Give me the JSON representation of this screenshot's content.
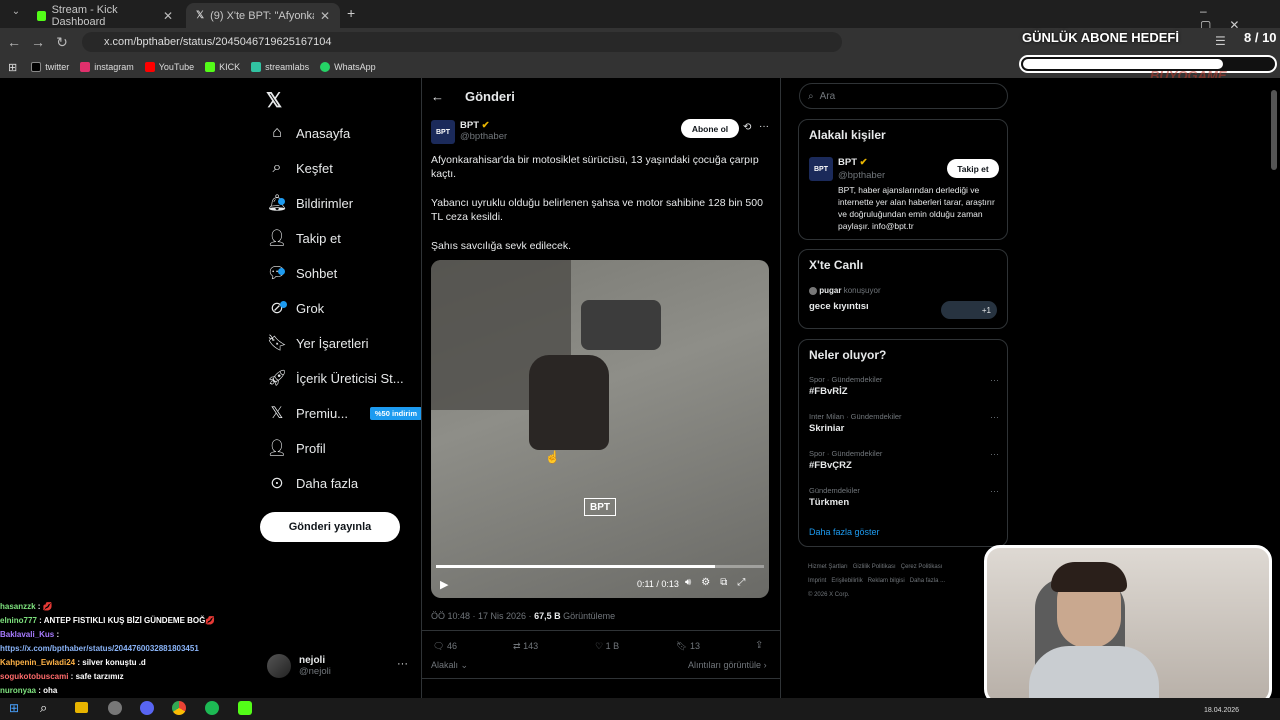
{
  "browser": {
    "tabs": [
      {
        "title": "Stream - Kick Dashboard"
      },
      {
        "title": "(9) X'te BPT: \"Afyonkarahisar'da"
      }
    ],
    "url": "x.com/bpthaber/status/2045046719625167104",
    "bookmarks": [
      "twitter",
      "instagram",
      "YouTube",
      "KICK",
      "streamlabs",
      "WhatsApp"
    ]
  },
  "overlay": {
    "goal_label": "GÜNLÜK ABONE HEDEFİ",
    "goal_count": "8 / 10",
    "goal_progress": 0.8,
    "watermark": "BUYOGAME"
  },
  "x": {
    "nav": [
      "Anasayfa",
      "Keşfet",
      "Bildirimler",
      "Takip et",
      "Sohbet",
      "Grok",
      "Yer İşaretleri",
      "İçerik Üreticisi St...",
      "Premiu...",
      "Profil",
      "Daha fazla"
    ],
    "premium_badge": "%50 indirim",
    "post_button": "Gönderi yayınla",
    "account": {
      "name": "nejoli",
      "handle": "@nejoli"
    },
    "header": "Gönderi",
    "post": {
      "author": "BPT",
      "handle": "@bpthaber",
      "subscribe": "Abone ol",
      "text1": "Afyonkarahisar'da bir motosiklet sürücüsü, 13 yaşındaki çocuğa çarpıp kaçtı.",
      "text2": "Yabancı uyruklu olduğu belirlenen şahsa ve motor sahibine 128 bin 500 TL ceza kesildi.",
      "text3": "Şahıs savcılığa sevk edilecek.",
      "video_logo": "BPT",
      "video_time": "0:11 / 0:13",
      "video_progress": 0.85,
      "meta_time": "ÖÖ 10:48 · 17 Nis 2026 · ",
      "views": "67,5 B",
      "views_label": " Görüntüleme",
      "replies": "46",
      "reposts": "143",
      "likes": "1 B",
      "bookmarks": "13",
      "sort": "Alakalı",
      "quotes": "Alıntıları görüntüle"
    },
    "search_placeholder": "Ara",
    "related": {
      "title": "Alakalı kişiler",
      "name": "BPT",
      "handle": "@bpthaber",
      "follow": "Takip et",
      "bio": "BPT, haber ajanslarından derlediği ve internette yer alan haberleri tarar, araştırır ve doğruluğundan emin olduğu zaman paylaşır. info@bpt.tr"
    },
    "live": {
      "title": "X'te Canlı",
      "host": "pugar",
      "host_suffix": " konuşuyor",
      "topic": "gece kıyıntısı",
      "extra": "+1"
    },
    "trends": {
      "title": "Neler oluyor?",
      "items": [
        {
          "cat": "Spor · Gündemdekiler",
          "name": "#FBvRİZ"
        },
        {
          "cat": "Inter Milan · Gündemdekiler",
          "name": "Skriniar"
        },
        {
          "cat": "Spor · Gündemdekiler",
          "name": "#FBvÇRZ"
        },
        {
          "cat": "Gündemdekiler",
          "name": "Türkmen"
        }
      ],
      "more": "Daha fazla göster"
    },
    "footer": [
      "Hizmet Şartları",
      "Gizlilik Politikası",
      "Çerez Politikası",
      "Imprint",
      "Erişilebilirlik",
      "Reklam bilgisi",
      "Daha fazla ...",
      "© 2026 X Corp."
    ]
  },
  "chat": [
    {
      "user": "hasanzzk",
      "color": "#7ee27e",
      "msg": " : 💋"
    },
    {
      "user": "elnino777",
      "color": "#7ee27e",
      "msg": " : ANTEP FISTIKLI KUŞ BİZİ GÜNDEME BOĞ💋"
    },
    {
      "user": "Baklavali_Kus",
      "color": "#a77bff",
      "msg": " :"
    },
    {
      "user": "",
      "color": "#8ab4f8",
      "msg": "https://x.com/bpthaber/status/2044760032881803451"
    },
    {
      "user": "Kahpenin_Ewladi24",
      "color": "#ffb347",
      "msg": " : silver konuştu .d"
    },
    {
      "user": "sogukotobuscami",
      "color": "#ff6b6b",
      "msg": " : safe tarzımız"
    },
    {
      "user": "nuronyaa",
      "color": "#7ee27e",
      "msg": " : oha"
    }
  ],
  "taskbar": {
    "date": "18.04.2026"
  }
}
